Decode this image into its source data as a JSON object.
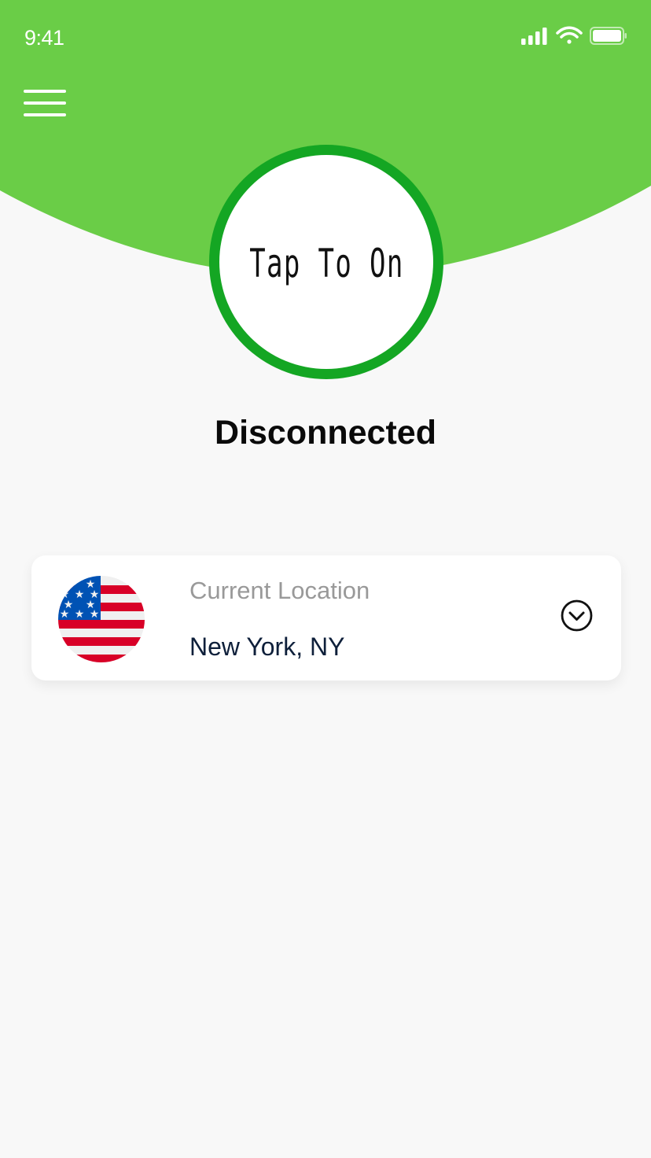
{
  "status_bar": {
    "time": "9:41",
    "icons": [
      "cellular-signal-icon",
      "wifi-icon",
      "battery-icon"
    ]
  },
  "header": {
    "menu_icon": "hamburger-menu-icon",
    "accent_color": "#6acd47"
  },
  "power_button": {
    "label": "Tap To On",
    "ring_color": "#14a623"
  },
  "connection": {
    "status": "Disconnected"
  },
  "location_card": {
    "flag_icon": "us-flag-icon",
    "caption": "Current Location",
    "value": "New York, NY",
    "dropdown_icon": "chevron-down-circle-icon"
  }
}
